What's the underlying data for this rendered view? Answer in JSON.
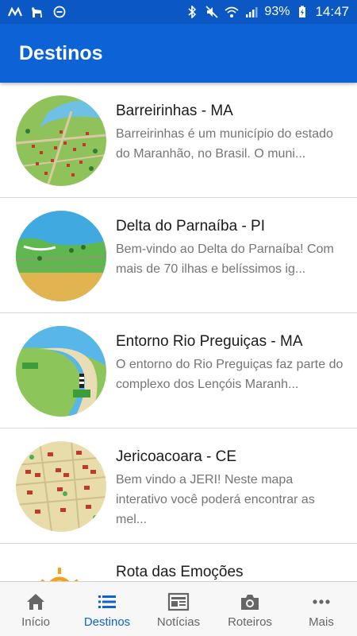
{
  "status": {
    "battery": "93%",
    "time": "14:47"
  },
  "header": {
    "title": "Destinos"
  },
  "items": [
    {
      "title": "Barreirinhas - MA",
      "desc": "Barreirinhas é um município do estado do Maranhão, no Brasil. O muni..."
    },
    {
      "title": "Delta do Parnaíba - PI",
      "desc": "Bem-vindo ao Delta do Parnaíba! Com mais de 70 ilhas e belíssimos ig..."
    },
    {
      "title": "Entorno Rio Preguiças - MA",
      "desc": "O entorno do Rio Preguiças faz parte do complexo dos Lençóis Maranh..."
    },
    {
      "title": "Jericoacoara - CE",
      "desc": "Bem vindo a JERI! Neste mapa interativo você poderá encontrar as mel..."
    },
    {
      "title": "Rota das Emoções",
      "desc": ""
    }
  ],
  "nav": [
    {
      "label": "Início",
      "icon": "home-icon"
    },
    {
      "label": "Destinos",
      "icon": "list-icon",
      "active": true
    },
    {
      "label": "Notícias",
      "icon": "newspaper-icon"
    },
    {
      "label": "Roteiros",
      "icon": "camera-icon"
    },
    {
      "label": "Mais",
      "icon": "more-icon"
    }
  ],
  "colors": {
    "primary": "#0d62d6",
    "statusbar": "#0b58c4"
  }
}
